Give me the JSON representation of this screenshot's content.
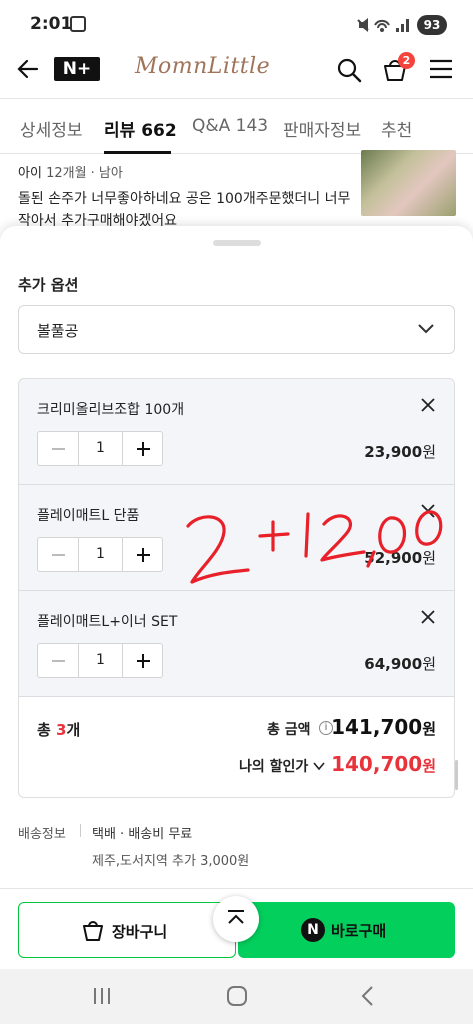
{
  "status_bar": {
    "time": "2:01",
    "battery": "93"
  },
  "header": {
    "brand_badge": "N+",
    "logo": "MomnLittle",
    "cart_count": "2",
    "icons": [
      "back-arrow-icon",
      "search-icon",
      "cart-icon",
      "menu-icon"
    ]
  },
  "tabs": [
    {
      "label": "상세정보"
    },
    {
      "label": "리뷰 662"
    },
    {
      "label": "Q&A 143"
    },
    {
      "label": "판매자정보"
    },
    {
      "label": "추천"
    }
  ],
  "review": {
    "author": "아이",
    "meta": "12개월 · 남아",
    "text": "돌된 손주가 너무좋아하네요 공은 100개주문했더니 너무작아서 추가구매해야겠어요"
  },
  "options": {
    "title": "추가 옵션",
    "selected": "볼풀공"
  },
  "items": [
    {
      "name": "크리미올리브조합 100개",
      "qty": "1",
      "price": "23,900",
      "unit": "원"
    },
    {
      "name": "플레이매트L 단품",
      "qty": "1",
      "price": "52,900",
      "unit": "원"
    },
    {
      "name": "플레이매트L+이너 SET",
      "qty": "1",
      "price": "64,900",
      "unit": "원"
    }
  ],
  "summary": {
    "count_prefix": "총 ",
    "count": "3",
    "count_suffix": "개",
    "total_label": "총 금액",
    "total": "141,700",
    "discount_label": "나의 할인가",
    "discount": "140,700",
    "unit": "원"
  },
  "shipping": {
    "label": "배송정보",
    "value": "택배 · 배송비 무료",
    "extra": "제주,도서지역 추가 3,000원"
  },
  "annotation": {
    "text": "2+12,00",
    "color": "#e8202a"
  },
  "buttons": {
    "cart": "장바구니",
    "buy": "바로구매",
    "buy_badge": "N"
  },
  "colors": {
    "accent_green": "#03cf5d",
    "sale_red": "#e8333b",
    "badge_red": "#f5443b"
  }
}
